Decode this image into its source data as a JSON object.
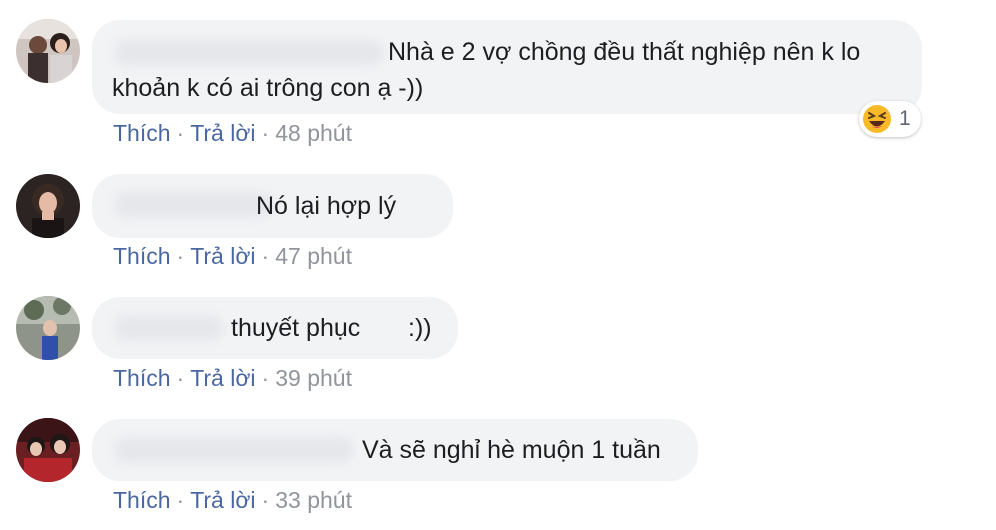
{
  "comments": [
    {
      "text_line1": "Nhà e 2 vợ chồng đều thất nghiệp nên k lo",
      "text_line2": "khoản k có ai trông con ạ -))",
      "like": "Thích",
      "reply": "Trả lời",
      "time": "48 phút",
      "reaction": {
        "icon": "laughing-emoji-icon",
        "count": "1"
      }
    },
    {
      "text": "Nó lại hợp lý",
      "like": "Thích",
      "reply": "Trả lời",
      "time": "47 phút"
    },
    {
      "text": "thuyết phục",
      "text_tail": ":))",
      "like": "Thích",
      "reply": "Trả lời",
      "time": "39 phút"
    },
    {
      "text": "Và sẽ nghỉ hè muộn 1 tuần",
      "like": "Thích",
      "reply": "Trả lời",
      "time": "33 phút"
    }
  ],
  "colors": {
    "link": "#4b67a1",
    "meta": "#90949c",
    "bubble": "#f2f3f5",
    "text": "#1c1e21"
  }
}
